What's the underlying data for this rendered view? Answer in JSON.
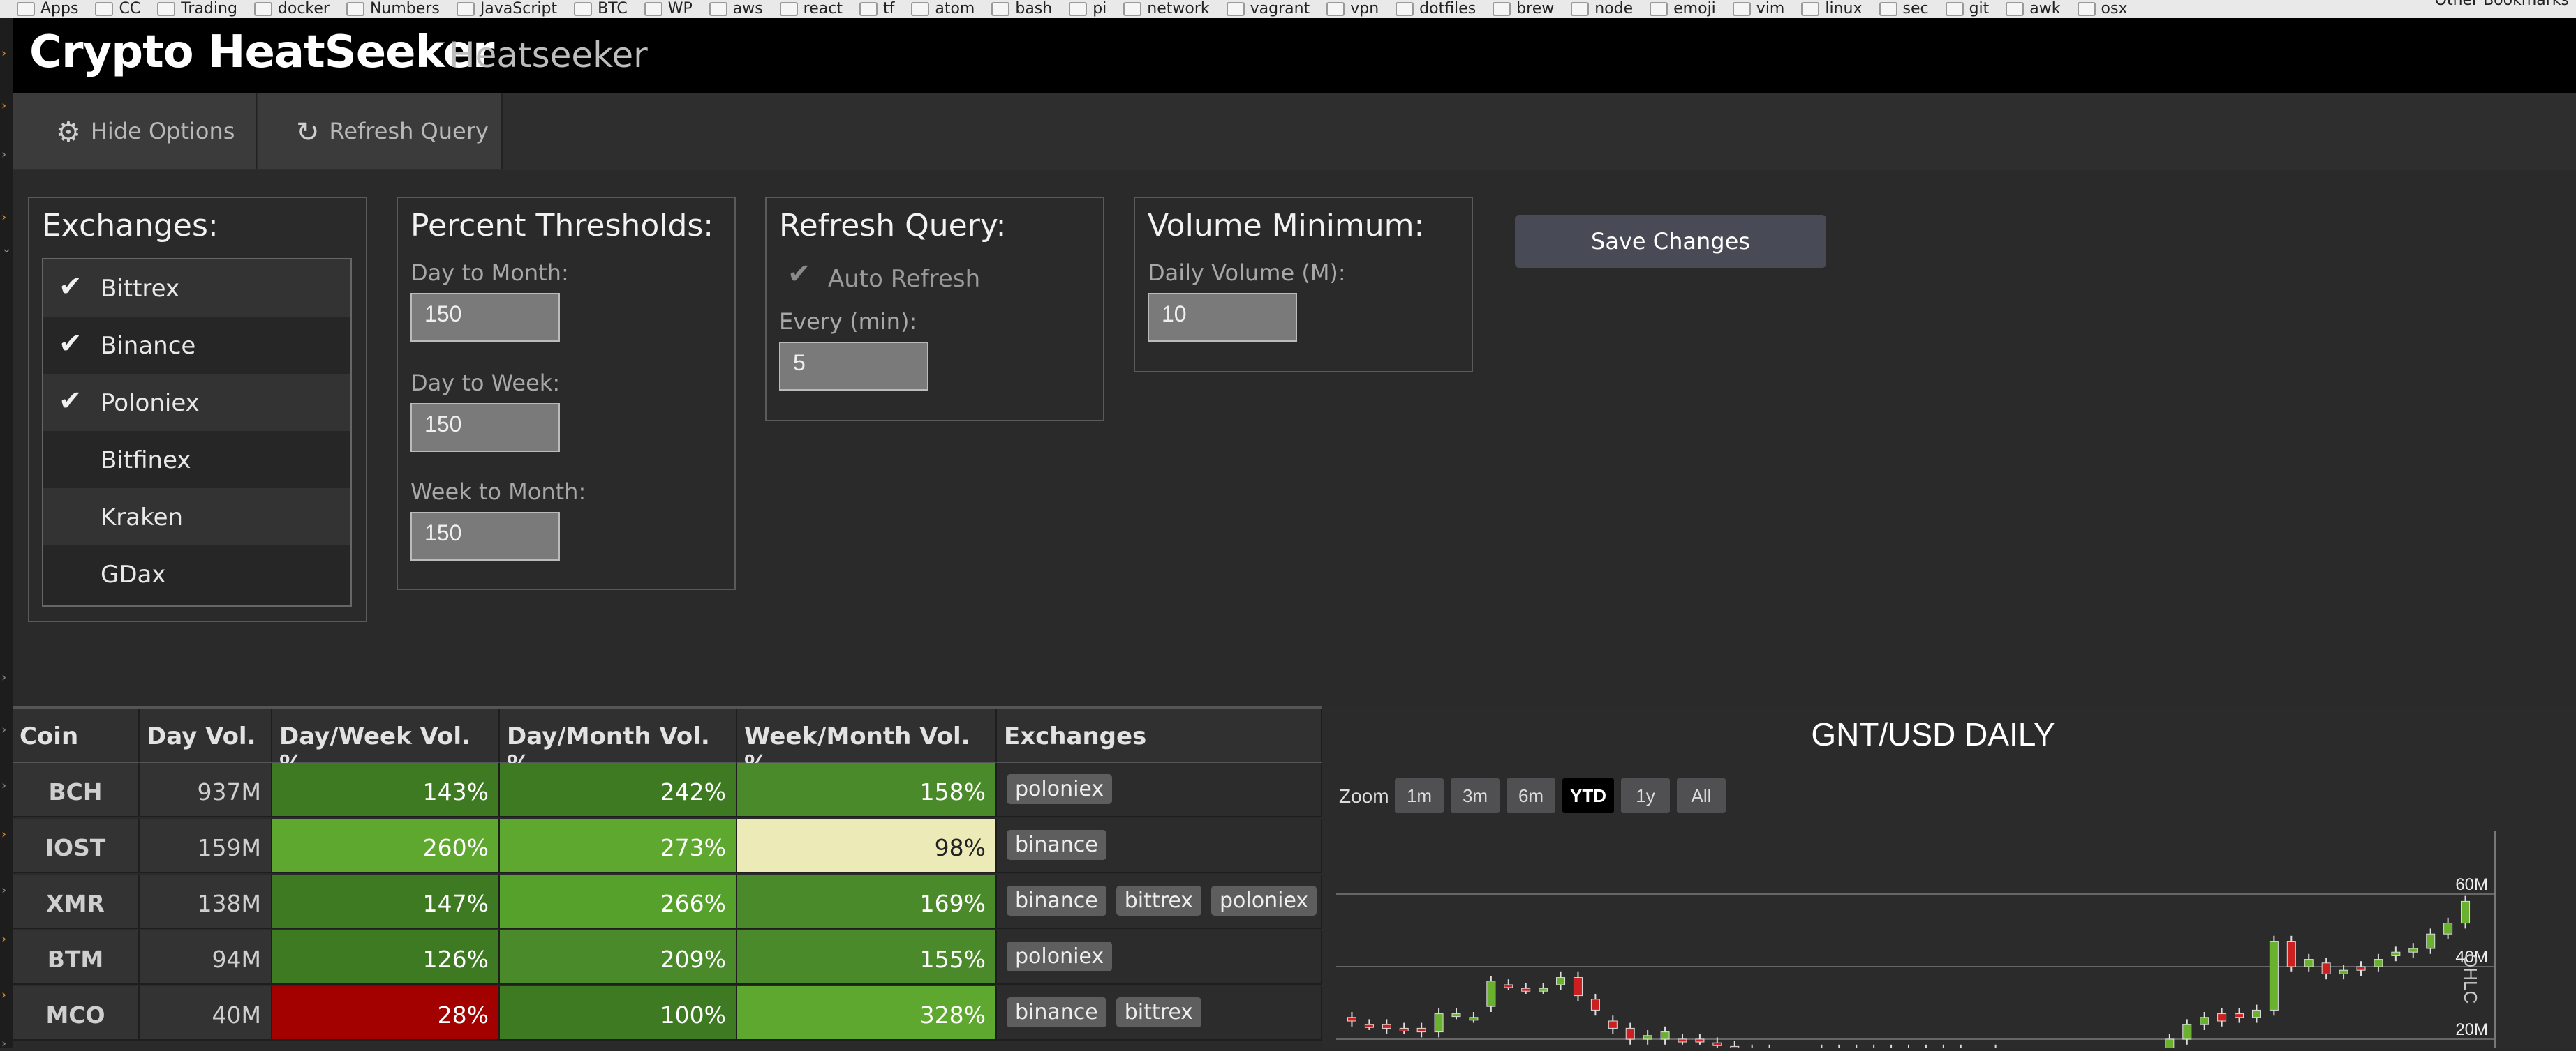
{
  "bookmarks": [
    "Apps",
    "CC",
    "Trading",
    "docker",
    "Numbers",
    "JavaScript",
    "BTC",
    "WP",
    "aws",
    "react",
    "tf",
    "atom",
    "bash",
    "pi",
    "network",
    "vagrant",
    "vpn",
    "dotfiles",
    "brew",
    "node",
    "emoji",
    "vim",
    "linux",
    "sec",
    "git",
    "awk",
    "osx"
  ],
  "bookmarks_other": "Other Bookmarks",
  "header": {
    "title": "Crypto HeatSeeker",
    "subtitle": "Heatseeker"
  },
  "toolbar": {
    "hide_options": "Hide Options",
    "refresh_query": "Refresh Query"
  },
  "exchanges": {
    "title": "Exchanges:",
    "items": [
      {
        "name": "Bittrex",
        "checked": true
      },
      {
        "name": "Binance",
        "checked": true
      },
      {
        "name": "Poloniex",
        "checked": true
      },
      {
        "name": "Bitfinex",
        "checked": false
      },
      {
        "name": "Kraken",
        "checked": false
      },
      {
        "name": "GDax",
        "checked": false
      }
    ]
  },
  "thresholds": {
    "title": "Percent Thresholds:",
    "day_to_month_label": "Day to Month:",
    "day_to_month": "150",
    "day_to_week_label": "Day to Week:",
    "day_to_week": "150",
    "week_to_month_label": "Week to Month:",
    "week_to_month": "150"
  },
  "refresh": {
    "title": "Refresh Query:",
    "auto_label": "Auto Refresh",
    "auto_checked": true,
    "every_label": "Every (min):",
    "every": "5"
  },
  "volume": {
    "title": "Volume Minimum:",
    "daily_label": "Daily Volume (M):",
    "daily": "10"
  },
  "save_label": "Save Changes",
  "table": {
    "headers": [
      "Coin",
      "Day Vol.",
      "Day/Week Vol. %",
      "Day/Month Vol. %",
      "Week/Month Vol. %",
      "Exchanges"
    ],
    "rows": [
      {
        "coin": "BCH",
        "day_vol": "937M",
        "dw": "143%",
        "dm": "242%",
        "wm": "158%",
        "exchanges": [
          "poloniex"
        ],
        "colors": [
          "#3e7a22",
          "#3e7a22",
          "#4a8a2a"
        ]
      },
      {
        "coin": "IOST",
        "day_vol": "159M",
        "dw": "260%",
        "dm": "273%",
        "wm": "98%",
        "exchanges": [
          "binance"
        ],
        "colors": [
          "#5fa830",
          "#5fa830",
          "#ecebb8"
        ]
      },
      {
        "coin": "XMR",
        "day_vol": "138M",
        "dw": "147%",
        "dm": "266%",
        "wm": "169%",
        "exchanges": [
          "binance",
          "bittrex",
          "poloniex"
        ],
        "colors": [
          "#3e7a22",
          "#56a02c",
          "#4a8a2a"
        ]
      },
      {
        "coin": "BTM",
        "day_vol": "94M",
        "dw": "126%",
        "dm": "209%",
        "wm": "155%",
        "exchanges": [
          "poloniex"
        ],
        "colors": [
          "#3e7a22",
          "#4a8a2a",
          "#4a8a2a"
        ]
      },
      {
        "coin": "MCO",
        "day_vol": "40M",
        "dw": "28%",
        "dm": "100%",
        "wm": "328%",
        "exchanges": [
          "binance",
          "bittrex"
        ],
        "colors": [
          "#a30000",
          "#3e7a22",
          "#5fa830"
        ]
      }
    ]
  },
  "chart": {
    "title": "GNT/USD DAILY",
    "zoom_label": "Zoom",
    "zoom_buttons": [
      "1m",
      "3m",
      "6m",
      "YTD",
      "1y",
      "All"
    ],
    "zoom_selected": "YTD",
    "side_label": "OHLC"
  },
  "chart_data": {
    "type": "candlestick",
    "title": "GNT/USD DAILY",
    "y_tick_labels": [
      "60M",
      "40M",
      "20M"
    ],
    "candles": [
      {
        "o": 25,
        "c": 26,
        "dir": "down"
      },
      {
        "o": 24,
        "c": 24,
        "dir": "down"
      },
      {
        "o": 24,
        "c": 23,
        "dir": "down"
      },
      {
        "o": 23,
        "c": 23,
        "dir": "down"
      },
      {
        "o": 23,
        "c": 22,
        "dir": "down"
      },
      {
        "o": 22,
        "c": 27,
        "dir": "up"
      },
      {
        "o": 27,
        "c": 27,
        "dir": "up"
      },
      {
        "o": 26,
        "c": 26,
        "dir": "up"
      },
      {
        "o": 29,
        "c": 36,
        "dir": "up"
      },
      {
        "o": 35,
        "c": 35,
        "dir": "down"
      },
      {
        "o": 34,
        "c": 34,
        "dir": "down"
      },
      {
        "o": 34,
        "c": 34,
        "dir": "up"
      },
      {
        "o": 35,
        "c": 37,
        "dir": "up"
      },
      {
        "o": 37,
        "c": 32,
        "dir": "down"
      },
      {
        "o": 31,
        "c": 28,
        "dir": "down"
      },
      {
        "o": 25,
        "c": 23,
        "dir": "down"
      },
      {
        "o": 23,
        "c": 20,
        "dir": "down"
      },
      {
        "o": 21,
        "c": 20,
        "dir": "up"
      },
      {
        "o": 20,
        "c": 22,
        "dir": "up"
      },
      {
        "o": 20,
        "c": 20,
        "dir": "down"
      },
      {
        "o": 20,
        "c": 20,
        "dir": "down"
      },
      {
        "o": 19,
        "c": 19,
        "dir": "down"
      },
      {
        "o": 18,
        "c": 17,
        "dir": "down"
      },
      {
        "o": 17,
        "c": 17,
        "dir": "up"
      },
      {
        "o": 17,
        "c": 16,
        "dir": "down"
      },
      {
        "o": 16,
        "c": 16,
        "dir": "down"
      },
      {
        "o": 15,
        "c": 15,
        "dir": "down"
      },
      {
        "o": 15,
        "c": 17,
        "dir": "up"
      },
      {
        "o": 17,
        "c": 17,
        "dir": "up"
      },
      {
        "o": 17,
        "c": 17,
        "dir": "up"
      },
      {
        "o": 17,
        "c": 17,
        "dir": "up"
      },
      {
        "o": 17,
        "c": 17,
        "dir": "up"
      },
      {
        "o": 17,
        "c": 17,
        "dir": "up"
      },
      {
        "o": 17,
        "c": 16,
        "dir": "down"
      },
      {
        "o": 16,
        "c": 17,
        "dir": "up"
      },
      {
        "o": 17,
        "c": 16,
        "dir": "down"
      },
      {
        "o": 16,
        "c": 16,
        "dir": "up"
      },
      {
        "o": 17,
        "c": 17,
        "dir": "up"
      },
      {
        "o": 15,
        "c": 14,
        "dir": "down"
      },
      {
        "o": 14,
        "c": 13,
        "dir": "down"
      },
      {
        "o": 13,
        "c": 13,
        "dir": "down"
      },
      {
        "o": 13,
        "c": 14,
        "dir": "up"
      },
      {
        "o": 14,
        "c": 14,
        "dir": "up"
      },
      {
        "o": 14,
        "c": 14,
        "dir": "down"
      },
      {
        "o": 14,
        "c": 14,
        "dir": "up"
      },
      {
        "o": 14,
        "c": 15,
        "dir": "up"
      },
      {
        "o": 15,
        "c": 16,
        "dir": "up"
      },
      {
        "o": 16,
        "c": 20,
        "dir": "up"
      },
      {
        "o": 20,
        "c": 24,
        "dir": "up"
      },
      {
        "o": 24,
        "c": 26,
        "dir": "up"
      },
      {
        "o": 25,
        "c": 27,
        "dir": "down"
      },
      {
        "o": 27,
        "c": 26,
        "dir": "down"
      },
      {
        "o": 26,
        "c": 28,
        "dir": "up"
      },
      {
        "o": 28,
        "c": 47,
        "dir": "up"
      },
      {
        "o": 47,
        "c": 40,
        "dir": "down"
      },
      {
        "o": 40,
        "c": 42,
        "dir": "up"
      },
      {
        "o": 41,
        "c": 38,
        "dir": "down"
      },
      {
        "o": 38,
        "c": 39,
        "dir": "up"
      },
      {
        "o": 39,
        "c": 40,
        "dir": "down"
      },
      {
        "o": 40,
        "c": 42,
        "dir": "up"
      },
      {
        "o": 43,
        "c": 44,
        "dir": "up"
      },
      {
        "o": 44,
        "c": 45,
        "dir": "up"
      },
      {
        "o": 45,
        "c": 49,
        "dir": "up"
      },
      {
        "o": 49,
        "c": 52,
        "dir": "up"
      },
      {
        "o": 52,
        "c": 58,
        "dir": "up"
      }
    ]
  }
}
